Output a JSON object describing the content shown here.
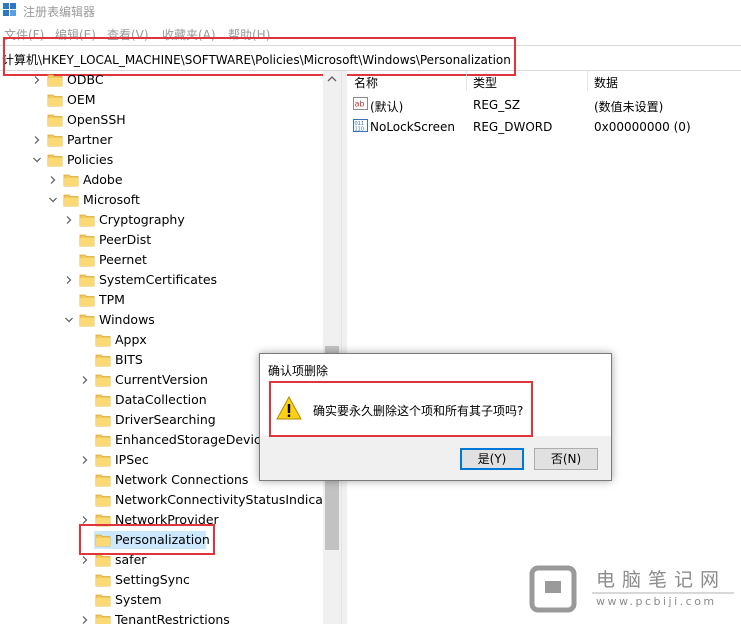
{
  "window": {
    "title": "注册表编辑器"
  },
  "menu": [
    "文件(F)",
    "编辑(E)",
    "查看(V)",
    "收藏夹(A)",
    "帮助(H)"
  ],
  "address": "计算机\\HKEY_LOCAL_MACHINE\\SOFTWARE\\Policies\\Microsoft\\Windows\\Personalization",
  "tree": [
    {
      "label": "ODBC",
      "depth": 0,
      "chevron": "right"
    },
    {
      "label": "OEM",
      "depth": 0,
      "chevron": "none"
    },
    {
      "label": "OpenSSH",
      "depth": 0,
      "chevron": "none"
    },
    {
      "label": "Partner",
      "depth": 0,
      "chevron": "right"
    },
    {
      "label": "Policies",
      "depth": 0,
      "chevron": "down"
    },
    {
      "label": "Adobe",
      "depth": 1,
      "chevron": "right"
    },
    {
      "label": "Microsoft",
      "depth": 1,
      "chevron": "down"
    },
    {
      "label": "Cryptography",
      "depth": 2,
      "chevron": "right"
    },
    {
      "label": "PeerDist",
      "depth": 2,
      "chevron": "none"
    },
    {
      "label": "Peernet",
      "depth": 2,
      "chevron": "none"
    },
    {
      "label": "SystemCertificates",
      "depth": 2,
      "chevron": "right"
    },
    {
      "label": "TPM",
      "depth": 2,
      "chevron": "none"
    },
    {
      "label": "Windows",
      "depth": 2,
      "chevron": "down"
    },
    {
      "label": "Appx",
      "depth": 3,
      "chevron": "none"
    },
    {
      "label": "BITS",
      "depth": 3,
      "chevron": "none"
    },
    {
      "label": "CurrentVersion",
      "depth": 3,
      "chevron": "right"
    },
    {
      "label": "DataCollection",
      "depth": 3,
      "chevron": "none"
    },
    {
      "label": "DriverSearching",
      "depth": 3,
      "chevron": "none"
    },
    {
      "label": "EnhancedStorageDevices",
      "depth": 3,
      "chevron": "none"
    },
    {
      "label": "IPSec",
      "depth": 3,
      "chevron": "right"
    },
    {
      "label": "Network Connections",
      "depth": 3,
      "chevron": "none"
    },
    {
      "label": "NetworkConnectivityStatusIndicator",
      "depth": 3,
      "chevron": "none"
    },
    {
      "label": "NetworkProvider",
      "depth": 3,
      "chevron": "right"
    },
    {
      "label": "Personalization",
      "depth": 3,
      "chevron": "none",
      "selected": true
    },
    {
      "label": "safer",
      "depth": 3,
      "chevron": "right"
    },
    {
      "label": "SettingSync",
      "depth": 3,
      "chevron": "none"
    },
    {
      "label": "System",
      "depth": 3,
      "chevron": "none"
    },
    {
      "label": "TenantRestrictions",
      "depth": 3,
      "chevron": "right"
    }
  ],
  "columns": {
    "name": "名称",
    "type": "类型",
    "data": "数据"
  },
  "values": [
    {
      "icon": "string-value-icon",
      "name": "(默认)",
      "type": "REG_SZ",
      "data": "(数值未设置)"
    },
    {
      "icon": "dword-value-icon",
      "name": "NoLockScreen",
      "type": "REG_DWORD",
      "data": "0x00000000 (0)"
    }
  ],
  "dialog": {
    "title": "确认项删除",
    "message": "确实要永久删除这个项和所有其子项吗?",
    "yes": "是(Y)",
    "no": "否(N)"
  },
  "watermark": {
    "name": "电脑笔记网",
    "url": "www.pcbiji.com"
  },
  "colors": {
    "highlight": "#e0353b",
    "folder": "#f5c85c",
    "accent": "#0078d7"
  }
}
